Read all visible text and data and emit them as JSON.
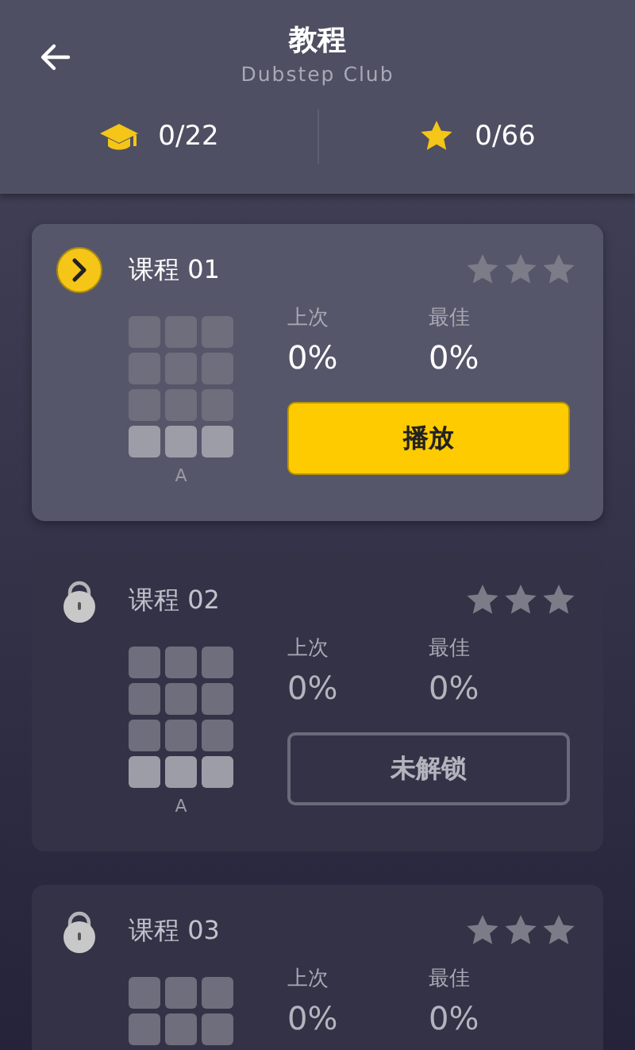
{
  "header": {
    "title": "教程",
    "subtitle": "Dubstep Club"
  },
  "summary": [
    {
      "kind": "lessons",
      "value": "0/22"
    },
    {
      "kind": "stars",
      "value": "0/66"
    }
  ],
  "lessons": [
    {
      "kind": "current",
      "title": "课程 01",
      "stars": 0,
      "grid_label": "A",
      "last_label": "上次",
      "last_value": "0%",
      "best_label": "最佳",
      "best_value": "0%",
      "button": "播放"
    },
    {
      "kind": "locked",
      "title": "课程 02",
      "stars": 0,
      "grid_label": "A",
      "last_label": "上次",
      "last_value": "0%",
      "best_label": "最佳",
      "best_value": "0%",
      "button": "未解锁"
    },
    {
      "kind": "locked",
      "title": "课程 03",
      "stars": 0,
      "last_label": "上次",
      "last_value": "0%",
      "best_label": "最佳",
      "best_value": "0%"
    }
  ]
}
